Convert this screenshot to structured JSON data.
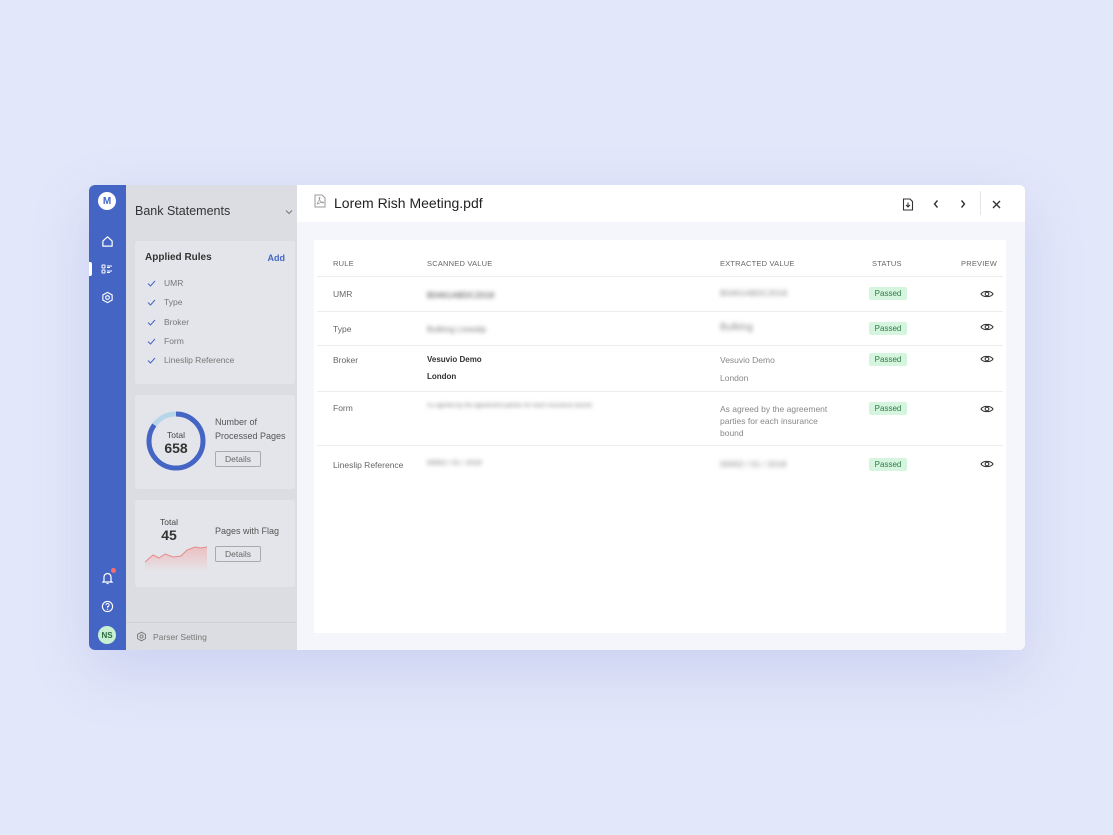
{
  "rail": {
    "logo": "M",
    "avatar": "NS"
  },
  "sidebar": {
    "title": "Bank Statements",
    "applied_rules": {
      "heading": "Applied Rules",
      "add_label": "Add",
      "items": [
        {
          "label": "UMR"
        },
        {
          "label": "Type"
        },
        {
          "label": "Broker"
        },
        {
          "label": "Form"
        },
        {
          "label": "Lineslip Reference"
        }
      ]
    },
    "processed": {
      "total_label": "Total",
      "total_value": "658",
      "label_line1": "Number of",
      "label_line2": "Processed Pages",
      "details_label": "Details",
      "fill_fraction": 0.85
    },
    "flagged": {
      "total_label": "Total",
      "total_value": "45",
      "label": "Pages with Flag",
      "details_label": "Details"
    },
    "parser_setting": "Parser Setting"
  },
  "document": {
    "filename": "Lorem Rish Meeting.pdf"
  },
  "table": {
    "headers": {
      "rule": "RULE",
      "scanned": "SCANNED VALUE",
      "extracted": "EXTRACTED VALUE",
      "status": "STATUS",
      "preview": "PREVIEW"
    },
    "rows": [
      {
        "rule": "UMR",
        "scanned": "B0461ABDC2018",
        "extracted": "B0461ABDC2018",
        "status": "Passed"
      },
      {
        "rule": "Type",
        "scanned": "Bulking Lineslip",
        "extracted": "Bulking",
        "status": "Passed"
      },
      {
        "rule": "Broker",
        "scanned_line1": "Vesuvio Demo",
        "scanned_line2": "London",
        "extracted_line1": "Vesuvio Demo",
        "extracted_line2": "London",
        "status": "Passed"
      },
      {
        "rule": "Form",
        "scanned": "As agreed by the agreement parties for each insurance bound",
        "extracted_line1": "As agreed by the agreement",
        "extracted_line2": "parties for each insurance",
        "extracted_line3": "bound",
        "status": "Passed"
      },
      {
        "rule": "Lineslip Reference",
        "scanned": "00002 / 01 / 2018",
        "extracted": "00002 / 01 / 2018",
        "status": "Passed"
      }
    ]
  },
  "colors": {
    "rail": "#4565c4",
    "passed_bg": "#d5f5de",
    "passed_text": "#2f7a46",
    "background": "#e3e7fa"
  }
}
